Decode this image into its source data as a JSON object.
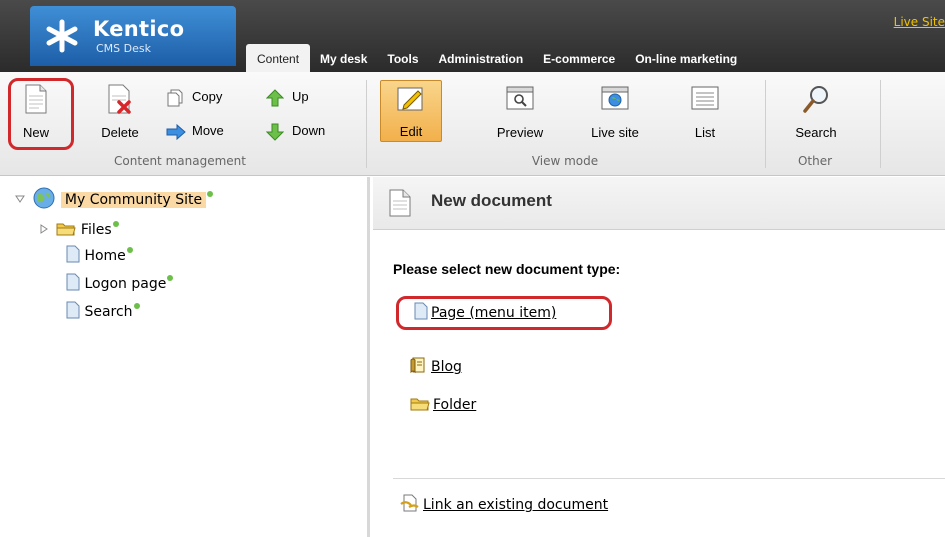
{
  "header": {
    "logo_name": "Kentico",
    "logo_sub": "CMS Desk",
    "live_site_link": "Live Site",
    "tabs": [
      {
        "label": "Content",
        "active": true
      },
      {
        "label": "My desk"
      },
      {
        "label": "Tools"
      },
      {
        "label": "Administration"
      },
      {
        "label": "E-commerce"
      },
      {
        "label": "On-line marketing"
      }
    ]
  },
  "ribbon": {
    "content_management": {
      "group_label": "Content management",
      "new_label": "New",
      "delete_label": "Delete",
      "copy_label": "Copy",
      "move_label": "Move",
      "up_label": "Up",
      "down_label": "Down"
    },
    "view_mode": {
      "group_label": "View mode",
      "edit_label": "Edit",
      "preview_label": "Preview",
      "live_site_label": "Live site",
      "list_label": "List"
    },
    "other": {
      "group_label": "Other",
      "search_label": "Search"
    }
  },
  "tree": {
    "root": "My Community Site",
    "items": [
      {
        "label": "Files",
        "icon": "folder-icon"
      },
      {
        "label": "Home",
        "icon": "page-icon"
      },
      {
        "label": "Logon page",
        "icon": "page-icon"
      },
      {
        "label": "Search",
        "icon": "page-icon"
      }
    ]
  },
  "panel": {
    "title": "New document",
    "prompt": "Please select new document type:",
    "doc_types": [
      {
        "label": "Page (menu item)",
        "icon": "page-icon"
      },
      {
        "label": "Blog",
        "icon": "blog-icon"
      },
      {
        "label": "Folder",
        "icon": "folder-icon"
      }
    ],
    "link_existing": "Link an existing document"
  },
  "colors": {
    "header_bg": "#2b2b2b",
    "logo_blue": "#1d5ea8",
    "live_link": "#f2c200",
    "highlight_red": "#d0282b",
    "status_dot": "#6cc04a",
    "edit_active": "#f2b04b"
  }
}
